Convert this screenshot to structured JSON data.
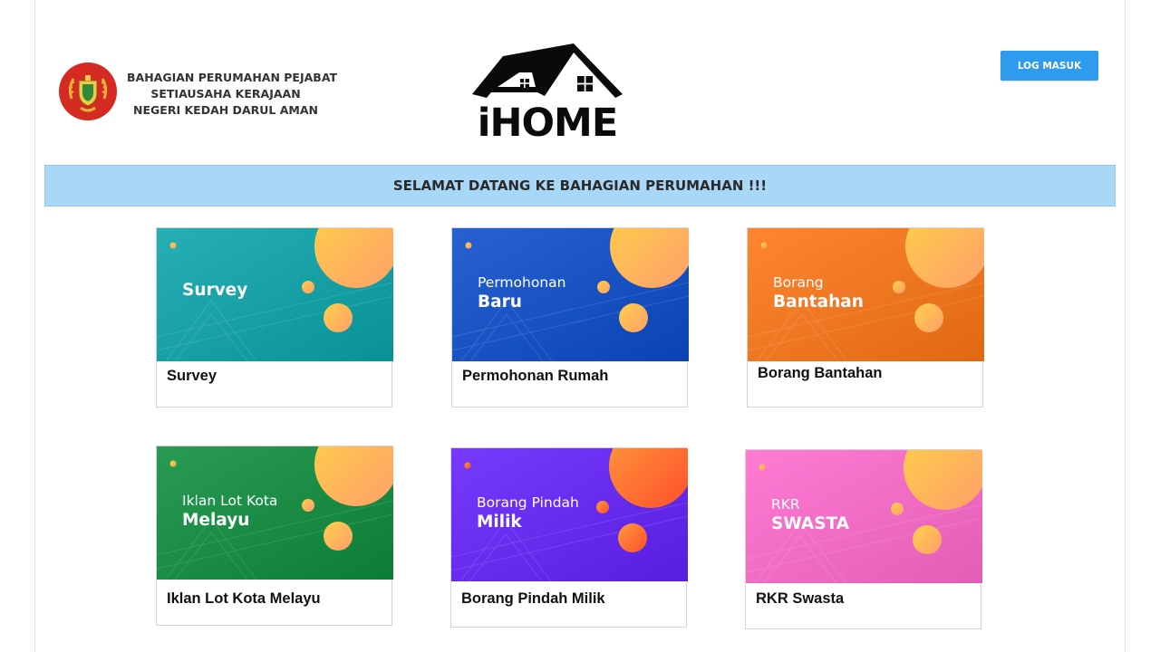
{
  "header": {
    "org_lines": [
      "BAHAGIAN PERUMAHAN PEJABAT",
      "SETIAUSAHA KERAJAAN",
      "NEGERI KEDAH DARUL AMAN"
    ],
    "logo_text": "iHOME",
    "login_label": "LOG MASUK"
  },
  "banner": {
    "text": "SELAMAT DATANG KE BAHAGIAN PERUMAHAN !!!"
  },
  "colors": {
    "login_button": "#2f9bef",
    "banner_bg": "#a9d7f8"
  },
  "cards": [
    {
      "line1": "",
      "line2": "Survey",
      "caption": "Survey",
      "color": "#1aa3a8"
    },
    {
      "line1": "Permohonan",
      "line2": "Baru",
      "caption": "Permohonan Rumah",
      "color": "#1c56c6"
    },
    {
      "line1": "Borang",
      "line2": "Bantahan",
      "caption": "Borang Bantahan",
      "color": "#f27a25"
    },
    {
      "line1": "Iklan Lot Kota",
      "line2": "Melayu",
      "caption": "Iklan Lot Kota Melayu",
      "color": "#1d8f48"
    },
    {
      "line1": "Borang Pindah",
      "line2": "Milik",
      "caption": "Borang Pindah Milik",
      "color": "#6a2ff0"
    },
    {
      "line1": "RKR",
      "line2": "SWASTA",
      "caption": "RKR Swasta",
      "color": "#f56fc8"
    }
  ]
}
